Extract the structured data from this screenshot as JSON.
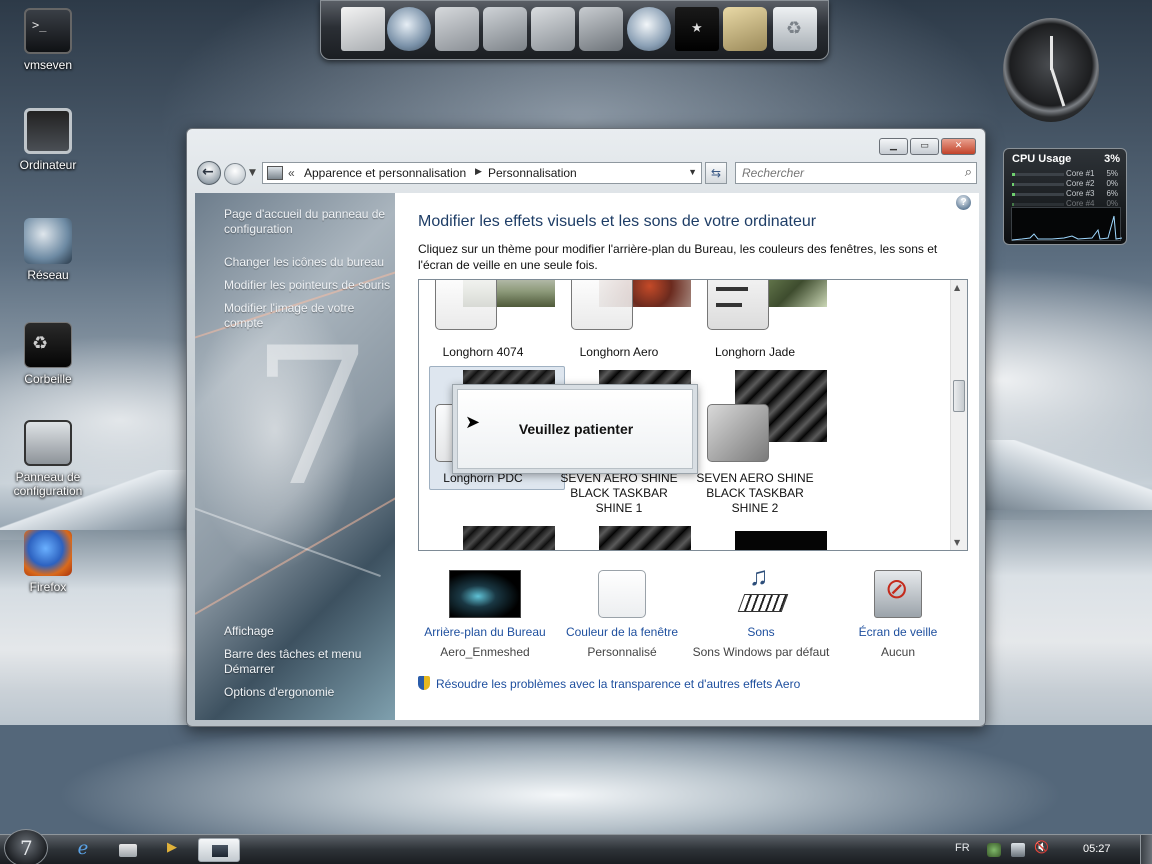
{
  "desktop": {
    "icons": [
      {
        "label": "vmseven",
        "icon": "console-icon"
      },
      {
        "label": "Ordinateur",
        "icon": "computer-icon"
      },
      {
        "label": "Réseau",
        "icon": "network-icon"
      },
      {
        "label": "Corbeille",
        "icon": "recycle-bin-icon"
      },
      {
        "label": "Panneau de configuration",
        "icon": "control-panel-icon"
      },
      {
        "label": "Firefox",
        "icon": "firefox-icon"
      }
    ]
  },
  "cpu_gadget": {
    "title": "CPU Usage",
    "total": "3%",
    "cores": [
      {
        "name": "Core #1",
        "value": "5%",
        "level": 0.05
      },
      {
        "name": "Core #2",
        "value": "0%",
        "level": 0.0
      },
      {
        "name": "Core #3",
        "value": "6%",
        "level": 0.06
      },
      {
        "name": "Core #4",
        "value": "0%",
        "level": 0.0
      }
    ]
  },
  "window": {
    "breadcrumb": [
      "Apparence et personnalisation",
      "Personnalisation"
    ],
    "search_placeholder": "Rechercher",
    "left_links_top": [
      "Page d'accueil du panneau de configuration",
      "Changer les icônes du bureau",
      "Modifier les pointeurs de souris",
      "Modifier l'image de votre compte"
    ],
    "left_links_bottom": [
      "Affichage",
      "Barre des tâches et menu Démarrer",
      "Options d'ergonomie"
    ],
    "title": "Modifier les effets visuels et les sons de votre ordinateur",
    "description": "Cliquez sur un thème pour modifier l'arrière-plan du Bureau, les couleurs des fenêtres, les sons et l'écran de veille en une seule fois.",
    "themes": [
      {
        "name": "Longhorn 4074"
      },
      {
        "name": "Longhorn Aero"
      },
      {
        "name": "Longhorn Jade"
      },
      {
        "name": "Longhorn PDC"
      },
      {
        "name": "SEVEN AERO SHINE BLACK TASKBAR SHINE 1"
      },
      {
        "name": "SEVEN AERO SHINE BLACK TASKBAR SHINE 2"
      }
    ],
    "wait_message": "Veuillez patienter",
    "options": [
      {
        "label": "Arrière-plan du Bureau",
        "value": "Aero_Enmeshed"
      },
      {
        "label": "Couleur de la fenêtre",
        "value": "Personnalisé"
      },
      {
        "label": "Sons",
        "value": "Sons Windows par défaut"
      },
      {
        "label": "Écran de veille",
        "value": "Aucun"
      }
    ],
    "aero_fix_link": "Résoudre les problèmes avec la transparence et d'autres effets Aero"
  },
  "taskbar": {
    "language": "FR",
    "time": "05:27"
  }
}
